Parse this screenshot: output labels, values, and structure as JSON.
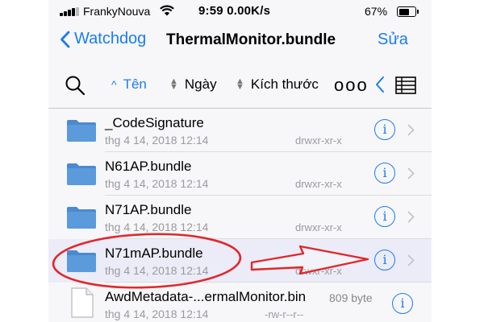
{
  "status_bar": {
    "carrier": "FrankyNouva",
    "time_speed": "9:59 0.00K/s",
    "battery_percent": "67%",
    "battery_level": 0.67
  },
  "nav": {
    "back_label": "Watchdog",
    "title": "ThermalMonitor.bundle",
    "edit_label": "Sửa"
  },
  "toolbar": {
    "sort_name": "Tên",
    "sort_date": "Ngày",
    "sort_size": "Kích thước",
    "more": "ooo"
  },
  "items": [
    {
      "name": "_CodeSignature",
      "date": "thg 4 14, 2018 12:14",
      "perm": "drwxr-xr-x"
    },
    {
      "name": "N61AP.bundle",
      "date": "thg 4 14, 2018 12:14",
      "perm": "drwxr-xr-x"
    },
    {
      "name": "N71AP.bundle",
      "date": "thg 4 14, 2018 12:14",
      "perm": "drwxr-xr-x"
    },
    {
      "name": "N71mAP.bundle",
      "date": "thg 4 14, 2018 12:14",
      "perm": "drwxr-xr-x"
    },
    {
      "name": "AwdMetadata-...ermalMonitor.bin",
      "date": "thg 4 14, 2018 12:14",
      "perm": "-rw-r--r--",
      "size": "809 byte"
    }
  ],
  "colors": {
    "accent": "#1a7cf5",
    "folder": "#4a8ad0",
    "annotation": "#e0282b"
  }
}
